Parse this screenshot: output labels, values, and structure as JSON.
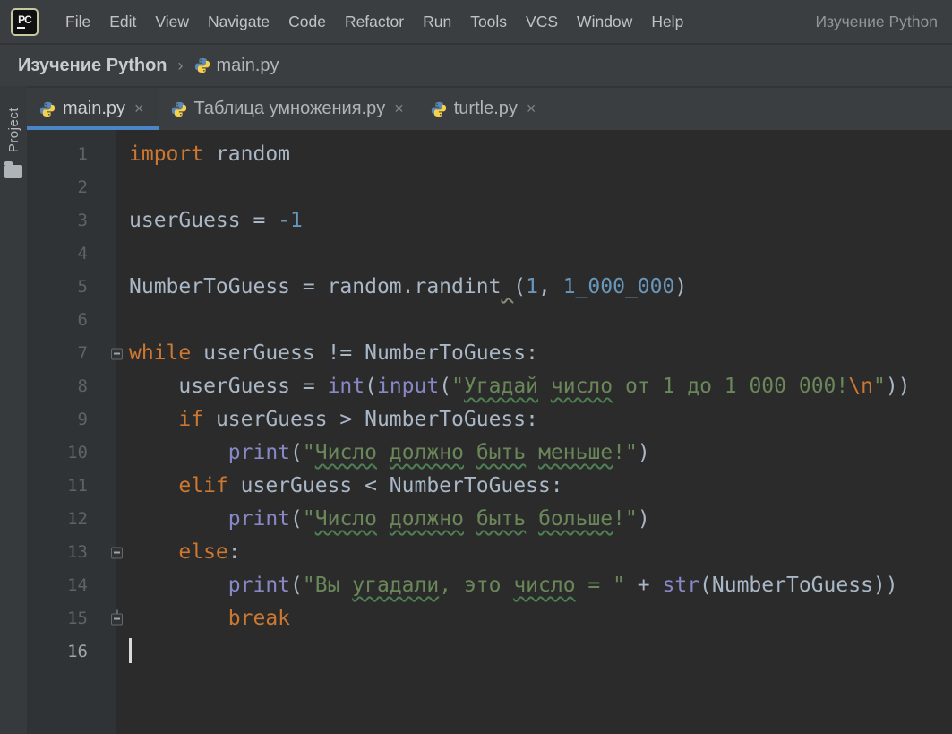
{
  "titlebar": {
    "logo_text": "PC",
    "menus": [
      {
        "pre": "",
        "u": "F",
        "post": "ile",
        "name": "menu-file"
      },
      {
        "pre": "",
        "u": "E",
        "post": "dit",
        "name": "menu-edit"
      },
      {
        "pre": "",
        "u": "V",
        "post": "iew",
        "name": "menu-view"
      },
      {
        "pre": "",
        "u": "N",
        "post": "avigate",
        "name": "menu-navigate"
      },
      {
        "pre": "",
        "u": "C",
        "post": "ode",
        "name": "menu-code"
      },
      {
        "pre": "",
        "u": "R",
        "post": "efactor",
        "name": "menu-refactor"
      },
      {
        "pre": "R",
        "u": "u",
        "post": "n",
        "name": "menu-run"
      },
      {
        "pre": "",
        "u": "T",
        "post": "ools",
        "name": "menu-tools"
      },
      {
        "pre": "VC",
        "u": "S",
        "post": "",
        "name": "menu-vcs"
      },
      {
        "pre": "",
        "u": "W",
        "post": "indow",
        "name": "menu-window"
      },
      {
        "pre": "",
        "u": "H",
        "post": "elp",
        "name": "menu-help"
      }
    ],
    "project_label": "Изучение Python"
  },
  "breadcrumb": {
    "project": "Изучение Python",
    "separator": "›",
    "file": "main.py"
  },
  "tool_strip": {
    "project_label": "Project"
  },
  "tabs": [
    {
      "label": "main.py",
      "close": "×",
      "active": true,
      "name": "tab-main-py"
    },
    {
      "label": "Таблица умножения.py",
      "close": "×",
      "active": false,
      "name": "tab-multiplication-table-py"
    },
    {
      "label": "turtle.py",
      "close": "×",
      "active": false,
      "name": "tab-turtle-py"
    }
  ],
  "colors": {
    "accent_blue": "#4a86c5",
    "keyword": "#cc7832",
    "identifier": "#a9b7c6",
    "number": "#6897bb",
    "string": "#6a8759",
    "builtin": "#8888c6",
    "typo_squiggle": "#4e8052",
    "editor_bg": "#2b2b2b",
    "panel_bg": "#3b3e40"
  },
  "editor": {
    "lines": [
      {
        "num": "1",
        "segments": [
          {
            "t": "import",
            "c": "kw"
          },
          {
            "t": " random",
            "c": "pl"
          }
        ]
      },
      {
        "num": "2",
        "segments": []
      },
      {
        "num": "3",
        "segments": [
          {
            "t": "userGuess = ",
            "c": "pl"
          },
          {
            "t": "-1",
            "c": "num"
          }
        ]
      },
      {
        "num": "4",
        "segments": []
      },
      {
        "num": "5",
        "segments": [
          {
            "t": "NumberToGuess = random.randint",
            "c": "pl"
          },
          {
            "t": " ",
            "c": "pl",
            "sq": "weak"
          },
          {
            "t": "(",
            "c": "pl"
          },
          {
            "t": "1",
            "c": "num"
          },
          {
            "t": ", ",
            "c": "pl"
          },
          {
            "t": "1_000_000",
            "c": "num"
          },
          {
            "t": ")",
            "c": "pl"
          }
        ]
      },
      {
        "num": "6",
        "segments": []
      },
      {
        "num": "7",
        "fold": "start",
        "segments": [
          {
            "t": "while",
            "c": "kw"
          },
          {
            "t": " userGuess != NumberToGuess:",
            "c": "pl"
          }
        ]
      },
      {
        "num": "8",
        "segments": [
          {
            "t": "    userGuess = ",
            "c": "pl"
          },
          {
            "t": "int",
            "c": "fn"
          },
          {
            "t": "(",
            "c": "pl"
          },
          {
            "t": "input",
            "c": "fn"
          },
          {
            "t": "(",
            "c": "pl"
          },
          {
            "t": "\"",
            "c": "str"
          },
          {
            "t": "Угадай",
            "c": "str",
            "sq": "typo"
          },
          {
            "t": " ",
            "c": "str"
          },
          {
            "t": "число",
            "c": "str",
            "sq": "typo"
          },
          {
            "t": " от 1 до 1 000 000!",
            "c": "str"
          },
          {
            "t": "\\n",
            "c": "esc"
          },
          {
            "t": "\"",
            "c": "str"
          },
          {
            "t": "))",
            "c": "pl"
          }
        ]
      },
      {
        "num": "9",
        "segments": [
          {
            "t": "    ",
            "c": "pl"
          },
          {
            "t": "if",
            "c": "kw"
          },
          {
            "t": " userGuess > NumberToGuess:",
            "c": "pl"
          }
        ]
      },
      {
        "num": "10",
        "segments": [
          {
            "t": "        ",
            "c": "pl"
          },
          {
            "t": "print",
            "c": "fn"
          },
          {
            "t": "(",
            "c": "pl"
          },
          {
            "t": "\"",
            "c": "str"
          },
          {
            "t": "Число",
            "c": "str",
            "sq": "typo"
          },
          {
            "t": " ",
            "c": "str"
          },
          {
            "t": "должно",
            "c": "str",
            "sq": "typo"
          },
          {
            "t": " ",
            "c": "str"
          },
          {
            "t": "быть",
            "c": "str",
            "sq": "typo"
          },
          {
            "t": " ",
            "c": "str"
          },
          {
            "t": "меньше",
            "c": "str",
            "sq": "typo"
          },
          {
            "t": "!\"",
            "c": "str"
          },
          {
            "t": ")",
            "c": "pl"
          }
        ]
      },
      {
        "num": "11",
        "segments": [
          {
            "t": "    ",
            "c": "pl"
          },
          {
            "t": "elif",
            "c": "kw"
          },
          {
            "t": " userGuess < NumberToGuess:",
            "c": "pl"
          }
        ]
      },
      {
        "num": "12",
        "segments": [
          {
            "t": "        ",
            "c": "pl"
          },
          {
            "t": "print",
            "c": "fn"
          },
          {
            "t": "(",
            "c": "pl"
          },
          {
            "t": "\"",
            "c": "str"
          },
          {
            "t": "Число",
            "c": "str",
            "sq": "typo"
          },
          {
            "t": " ",
            "c": "str"
          },
          {
            "t": "должно",
            "c": "str",
            "sq": "typo"
          },
          {
            "t": " ",
            "c": "str"
          },
          {
            "t": "быть",
            "c": "str",
            "sq": "typo"
          },
          {
            "t": " ",
            "c": "str"
          },
          {
            "t": "больше",
            "c": "str",
            "sq": "typo"
          },
          {
            "t": "!\"",
            "c": "str"
          },
          {
            "t": ")",
            "c": "pl"
          }
        ]
      },
      {
        "num": "13",
        "fold": "start",
        "segments": [
          {
            "t": "    ",
            "c": "pl"
          },
          {
            "t": "else",
            "c": "kw"
          },
          {
            "t": ":",
            "c": "pl"
          }
        ]
      },
      {
        "num": "14",
        "segments": [
          {
            "t": "        ",
            "c": "pl"
          },
          {
            "t": "print",
            "c": "fn"
          },
          {
            "t": "(",
            "c": "pl"
          },
          {
            "t": "\"Вы ",
            "c": "str"
          },
          {
            "t": "угадали",
            "c": "str",
            "sq": "typo"
          },
          {
            "t": ", это ",
            "c": "str"
          },
          {
            "t": "число",
            "c": "str",
            "sq": "typo"
          },
          {
            "t": " = \"",
            "c": "str"
          },
          {
            "t": " + ",
            "c": "pl"
          },
          {
            "t": "str",
            "c": "fn"
          },
          {
            "t": "(NumberToGuess))",
            "c": "pl"
          }
        ]
      },
      {
        "num": "15",
        "fold": "end",
        "segments": [
          {
            "t": "        ",
            "c": "pl"
          },
          {
            "t": "break",
            "c": "kw"
          }
        ]
      },
      {
        "num": "16",
        "current": true,
        "caret": true,
        "segments": []
      }
    ]
  }
}
